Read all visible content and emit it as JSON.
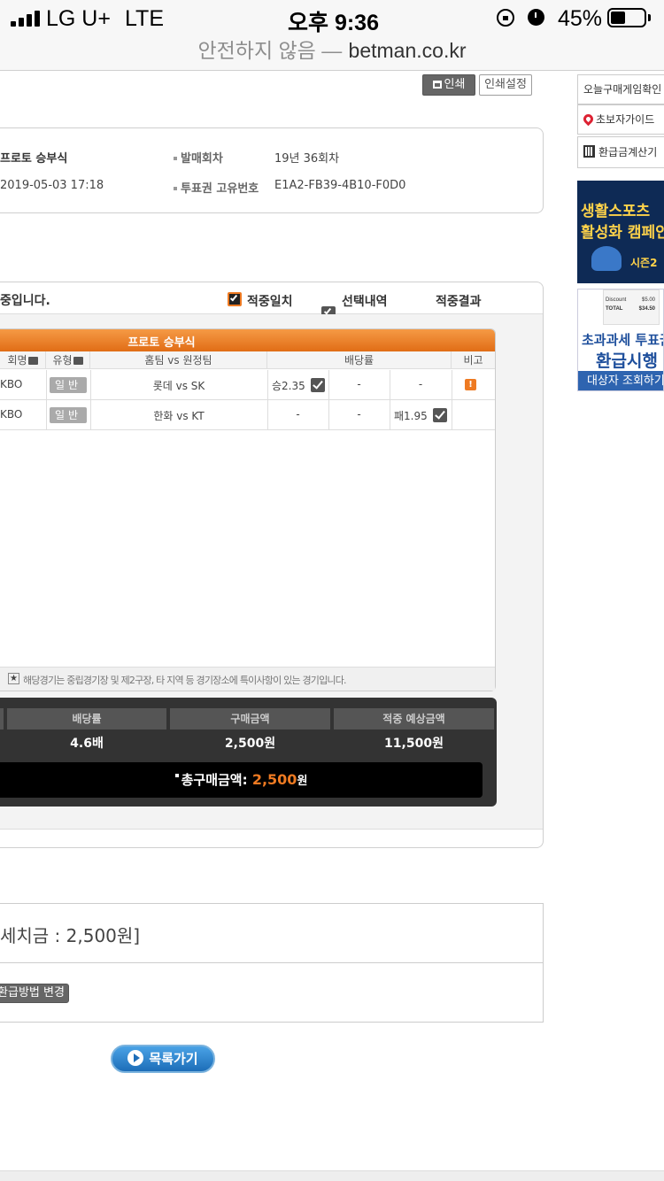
{
  "status_bar": {
    "carrier": "LG U+",
    "network": "LTE",
    "time": "오후 9:36",
    "battery": "45%",
    "battery_level": 0.45
  },
  "address_bar": {
    "insecure_label": "안전하지 않음 —",
    "domain": "betman.co.kr"
  },
  "toolbar": {
    "print_label": "인쇄",
    "print_settings_label": "인쇄설정"
  },
  "ticket_info": {
    "game_name": "프로토 승부식",
    "purchase_datetime": "2019-05-03 17:18",
    "round_label": "발매회차",
    "round_value": "19년 36회차",
    "ticket_id_label": "투표권 고유번호",
    "ticket_id_value": "E1A2-FB39-4B10-F0D0"
  },
  "sidebar": {
    "today_games": "오늘구매게임확인",
    "beginner_guide": "초보자가이드",
    "refund_calc": "환급금계산기",
    "banner1_line1": "생활스포츠",
    "banner1_line2": "활성화 캠페인",
    "banner1_season": "시즌2",
    "receipt_discount": "Discount",
    "receipt_discount_val": "$5.00",
    "receipt_total": "TOTAL",
    "receipt_total_val": "$34.50",
    "banner2_line1": "초과과세 투표권",
    "banner2_line2": "환급시행",
    "banner2_footer": "대상자 조회하기"
  },
  "section": {
    "title_tail": "중입니다.",
    "legend": {
      "match": "적중일치",
      "selection": "선택내역",
      "result": "적중결과"
    }
  },
  "table": {
    "title": "프로토 승부식",
    "headers": {
      "league": "회명",
      "type": "유형",
      "teams": "홈팀 vs 원정팀",
      "odds": "배당률",
      "note": "비고"
    },
    "rows": [
      {
        "league": "KBO",
        "type": "일반",
        "teams": "롯데 vs SK",
        "odds_win": "승2.35",
        "odds_draw": "-",
        "odds_loss": "-",
        "note": "!"
      },
      {
        "league": "KBO",
        "type": "일반",
        "teams": "한화 vs KT",
        "odds_win": "-",
        "odds_draw": "-",
        "odds_loss": "패1.95",
        "note": ""
      }
    ],
    "footnote": "해당경기는 중립경기장 및 제2구장, 타 지역 등 경기장소에 특이사항이 있는 경기입니다."
  },
  "summary": {
    "headers": {
      "odds": "배당률",
      "amount": "구매금액",
      "expected": "적중 예상금액"
    },
    "values": {
      "odds": "4.6배",
      "amount": "2,500원",
      "expected": "11,500원"
    },
    "total_label": "총구매금액:",
    "total_value": "2,500",
    "total_unit": "원"
  },
  "refund": {
    "text": "세치금 : 2,500원]",
    "change_button": "환급방법 변경"
  },
  "list_button": "목록가기",
  "colors": {
    "accent_orange": "#ee7a22",
    "dark_panel": "#333333",
    "banner_navy": "#0e2a55",
    "banner_blue": "#2e64b0"
  }
}
